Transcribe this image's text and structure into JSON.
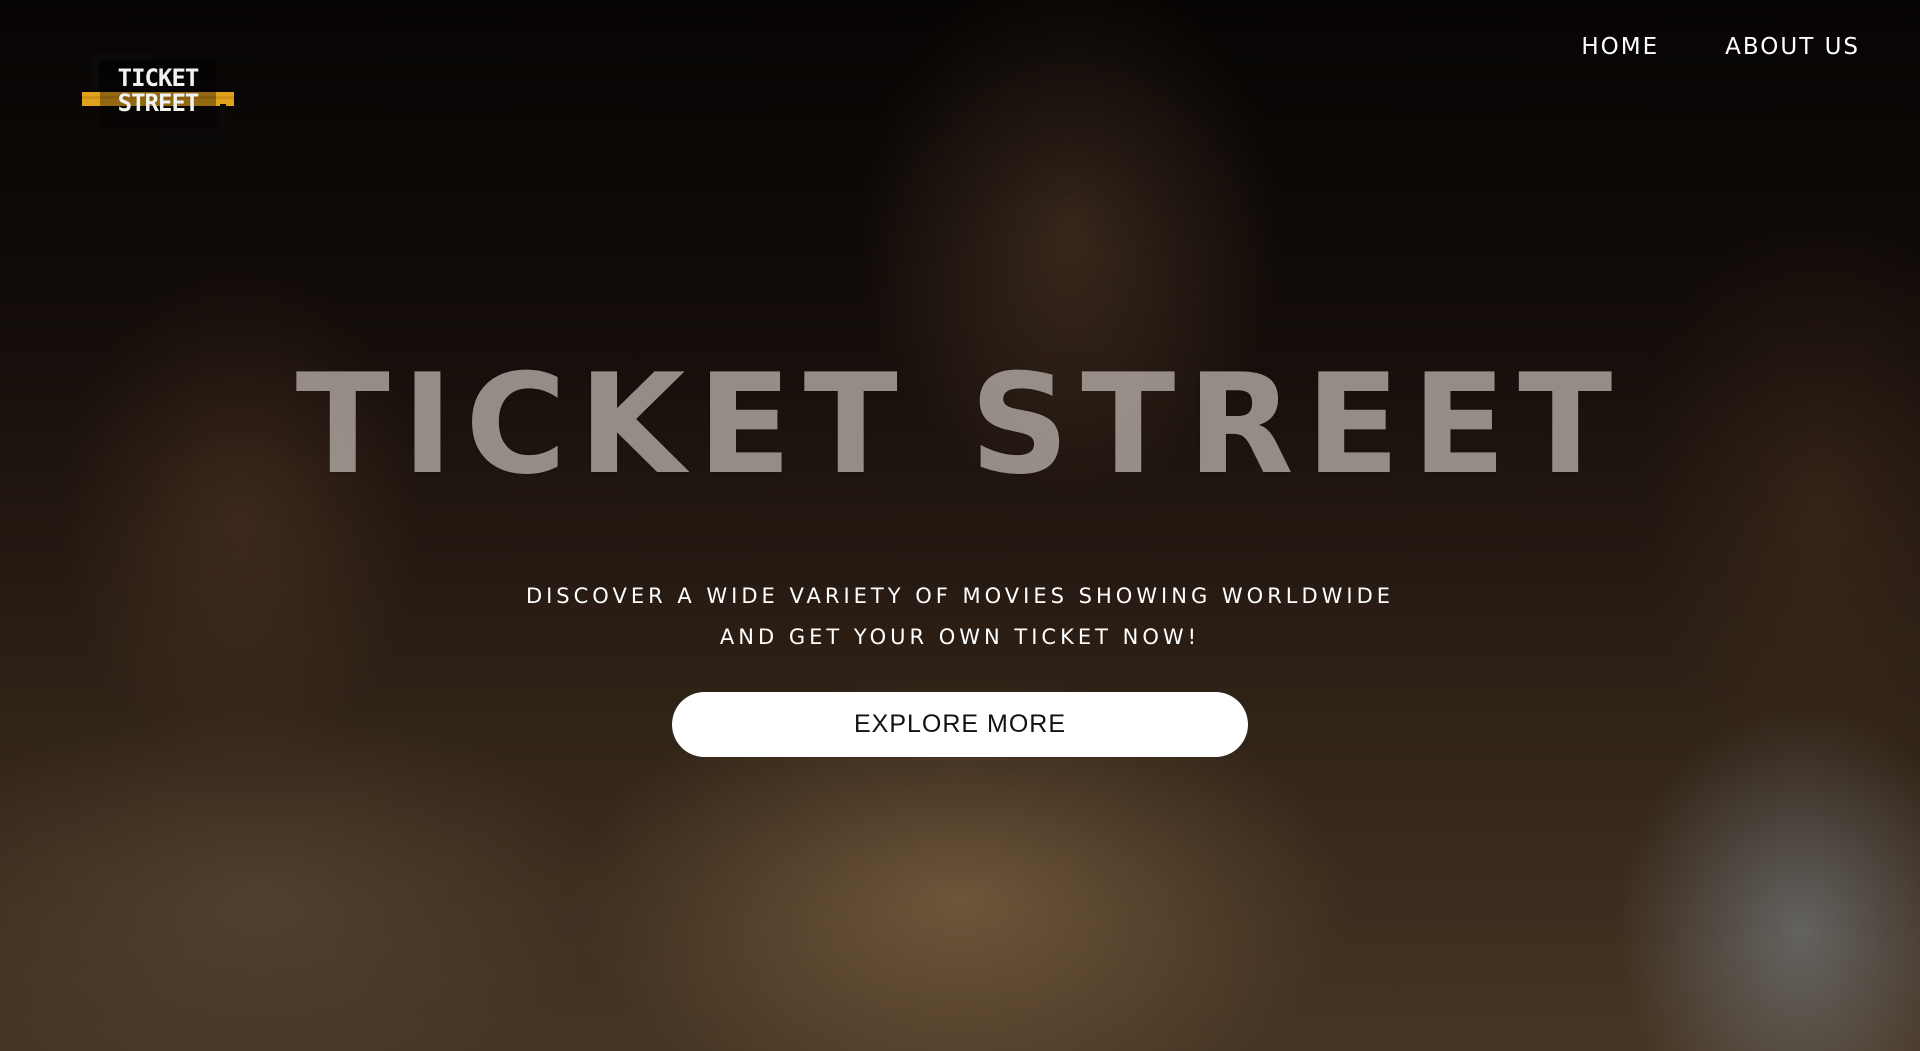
{
  "logo": {
    "text_line1": "TICKET",
    "text_line2": "STREET",
    "accent_color": "#e0a21c"
  },
  "nav": {
    "items": [
      {
        "label": "HOME"
      },
      {
        "label": "ABOUT US"
      }
    ]
  },
  "hero": {
    "title": "TICKET STREET",
    "tagline_line1": "DISCOVER A WIDE VARIETY OF MOVIES SHOWING WORLDWIDE",
    "tagline_line2": "AND GET YOUR OWN TICKET NOW!",
    "cta_label": "EXPLORE MORE"
  }
}
